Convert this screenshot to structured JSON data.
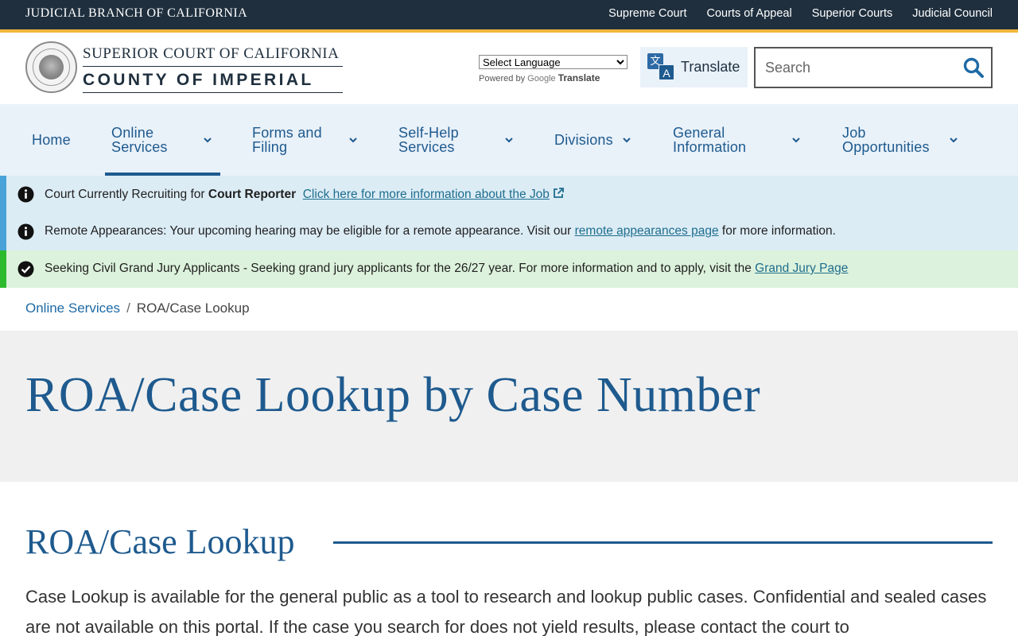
{
  "topbar": {
    "branch": "JUDICIAL BRANCH OF CALIFORNIA",
    "links": [
      "Supreme Court",
      "Courts of Appeal",
      "Superior Courts",
      "Judicial Council"
    ]
  },
  "header": {
    "court_line1": "SUPERIOR COURT OF CALIFORNIA",
    "court_line2": "COUNTY OF IMPERIAL",
    "language_select": "Select Language",
    "powered_by": "Powered by",
    "google": "Google",
    "translate_brand": "Translate",
    "translate_button": "Translate",
    "search_placeholder": "Search"
  },
  "nav": {
    "items": [
      {
        "label": "Home"
      },
      {
        "label": "Online\nServices"
      },
      {
        "label": "Forms and\nFiling"
      },
      {
        "label": "Self-Help\nServices"
      },
      {
        "label": "Divisions"
      },
      {
        "label": "General\nInformation"
      },
      {
        "label": "Job\nOpportunities"
      }
    ],
    "active": "Online Services"
  },
  "alerts": [
    {
      "prefix": "Court Currently Recruiting for ",
      "strong": "Court Reporter",
      "link": "Click here for more information about the Job"
    },
    {
      "prefix": "Remote Appearances: Your upcoming hearing may be eligible for a remote appearance. Visit our ",
      "link": "remote appearances page",
      "suffix": " for more information."
    },
    {
      "prefix": "Seeking Civil Grand Jury Applicants - Seeking grand jury applicants for the 26/27 year. For more information and to apply, visit the ",
      "link": "Grand Jury Page"
    }
  ],
  "breadcrumb": {
    "parent": "Online Services",
    "separator": "/",
    "current": "ROA/Case Lookup"
  },
  "page": {
    "title": "ROA/Case Lookup by Case Number",
    "section_title": "ROA/Case Lookup",
    "body": "Case Lookup is available for the general public as a tool to research and lookup public cases. Confidential and sealed cases are not available on this portal. If the case you search for does not yield results, please contact the court to"
  },
  "colors": {
    "topbar": "#1f2f3e",
    "gold": "#f2b73b",
    "brand_blue": "#1e5a8e",
    "nav_bg": "#e9f1f9",
    "info_bg": "#dcecf5",
    "info_border": "#4aa3d8",
    "ok_bg": "#ddf2dc",
    "ok_border": "#2dbb2d",
    "hero_bg": "#f0f0f0"
  },
  "icons": [
    "search-icon",
    "translate-icon",
    "chevron-down-icon",
    "info-icon",
    "check-circle-icon",
    "external-link-icon",
    "court-seal-logo"
  ]
}
